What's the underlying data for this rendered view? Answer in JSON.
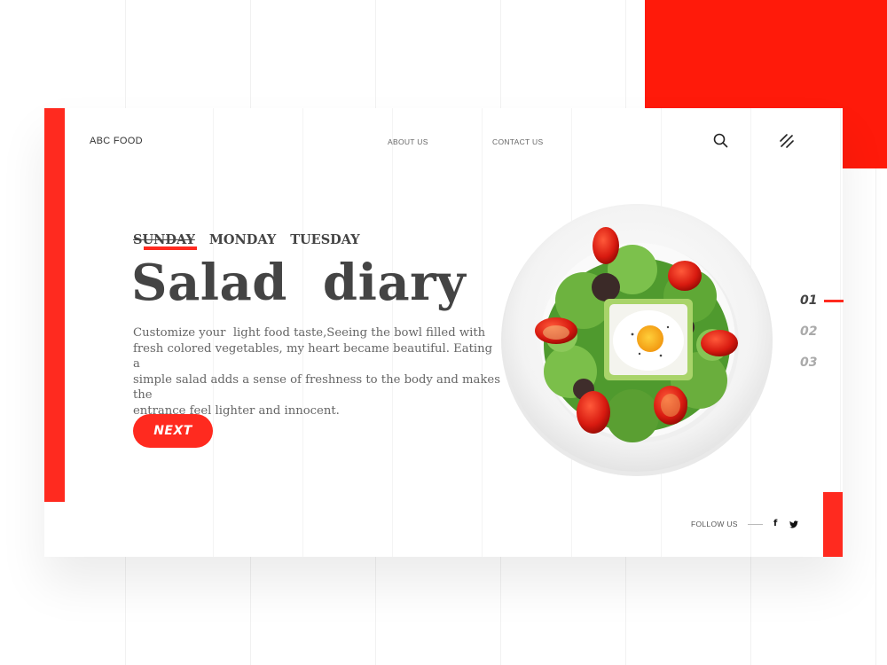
{
  "brand": {
    "logo": "ABC FOOD"
  },
  "nav": {
    "about": "ABOUT US",
    "contact": "CONTACT US"
  },
  "icons": {
    "search": "search-icon",
    "menu": "menu-slash-icon",
    "facebook": "facebook-icon",
    "twitter": "twitter-icon"
  },
  "days": [
    {
      "label": "SUNDAY",
      "active": true
    },
    {
      "label": "MONDAY",
      "active": false
    },
    {
      "label": "TUESDAY",
      "active": false
    }
  ],
  "hero": {
    "title": "Salad  diary",
    "description": "Customize your  light food taste,Seeing the bowl filled with\nfresh colored vegetables, my heart became beautiful. Eating a\nsimple salad adds a sense of freshness to the body and makes the\nentrance feel lighter and innocent.",
    "button_label": "NEXT"
  },
  "pager": [
    {
      "label": "01",
      "active": true
    },
    {
      "label": "02",
      "active": false
    },
    {
      "label": "03",
      "active": false
    }
  ],
  "footer": {
    "follow_label": "FOLLOW US",
    "facebook_glyph": "f",
    "twitter_glyph": "🐦"
  },
  "colors": {
    "accent": "#ff2a1f",
    "text": "#444444"
  }
}
